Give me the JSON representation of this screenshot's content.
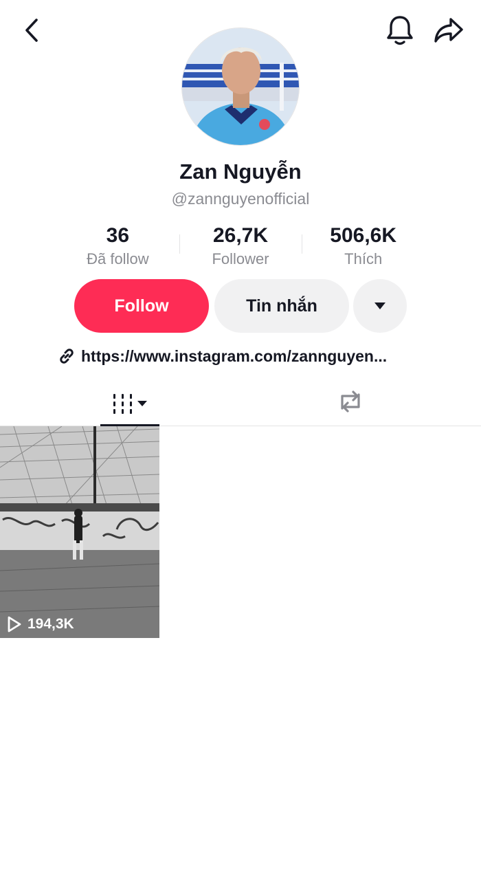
{
  "profile": {
    "name": "Zan Nguyễn",
    "handle": "@zannguyenofficial",
    "link": "https://www.instagram.com/zannguyen..."
  },
  "stats": [
    {
      "value": "36",
      "label": "Đã follow"
    },
    {
      "value": "26,7K",
      "label": "Follower"
    },
    {
      "value": "506,6K",
      "label": "Thích"
    }
  ],
  "actions": {
    "follow_label": "Follow",
    "message_label": "Tin nhắn"
  },
  "icons": {
    "back": "chevron-left-icon",
    "bell": "bell-icon",
    "share": "share-arrow-icon",
    "more": "caret-down-icon",
    "link": "link-icon",
    "videos_tab": "grid-bars-icon",
    "reposts_tab": "repost-icon",
    "play": "play-icon"
  },
  "videos": [
    {
      "views": "194,3K"
    }
  ],
  "colors": {
    "accent": "#fe2c55",
    "secondary_button": "#f1f1f2",
    "muted_text": "#8a8b91",
    "text": "#161823"
  }
}
